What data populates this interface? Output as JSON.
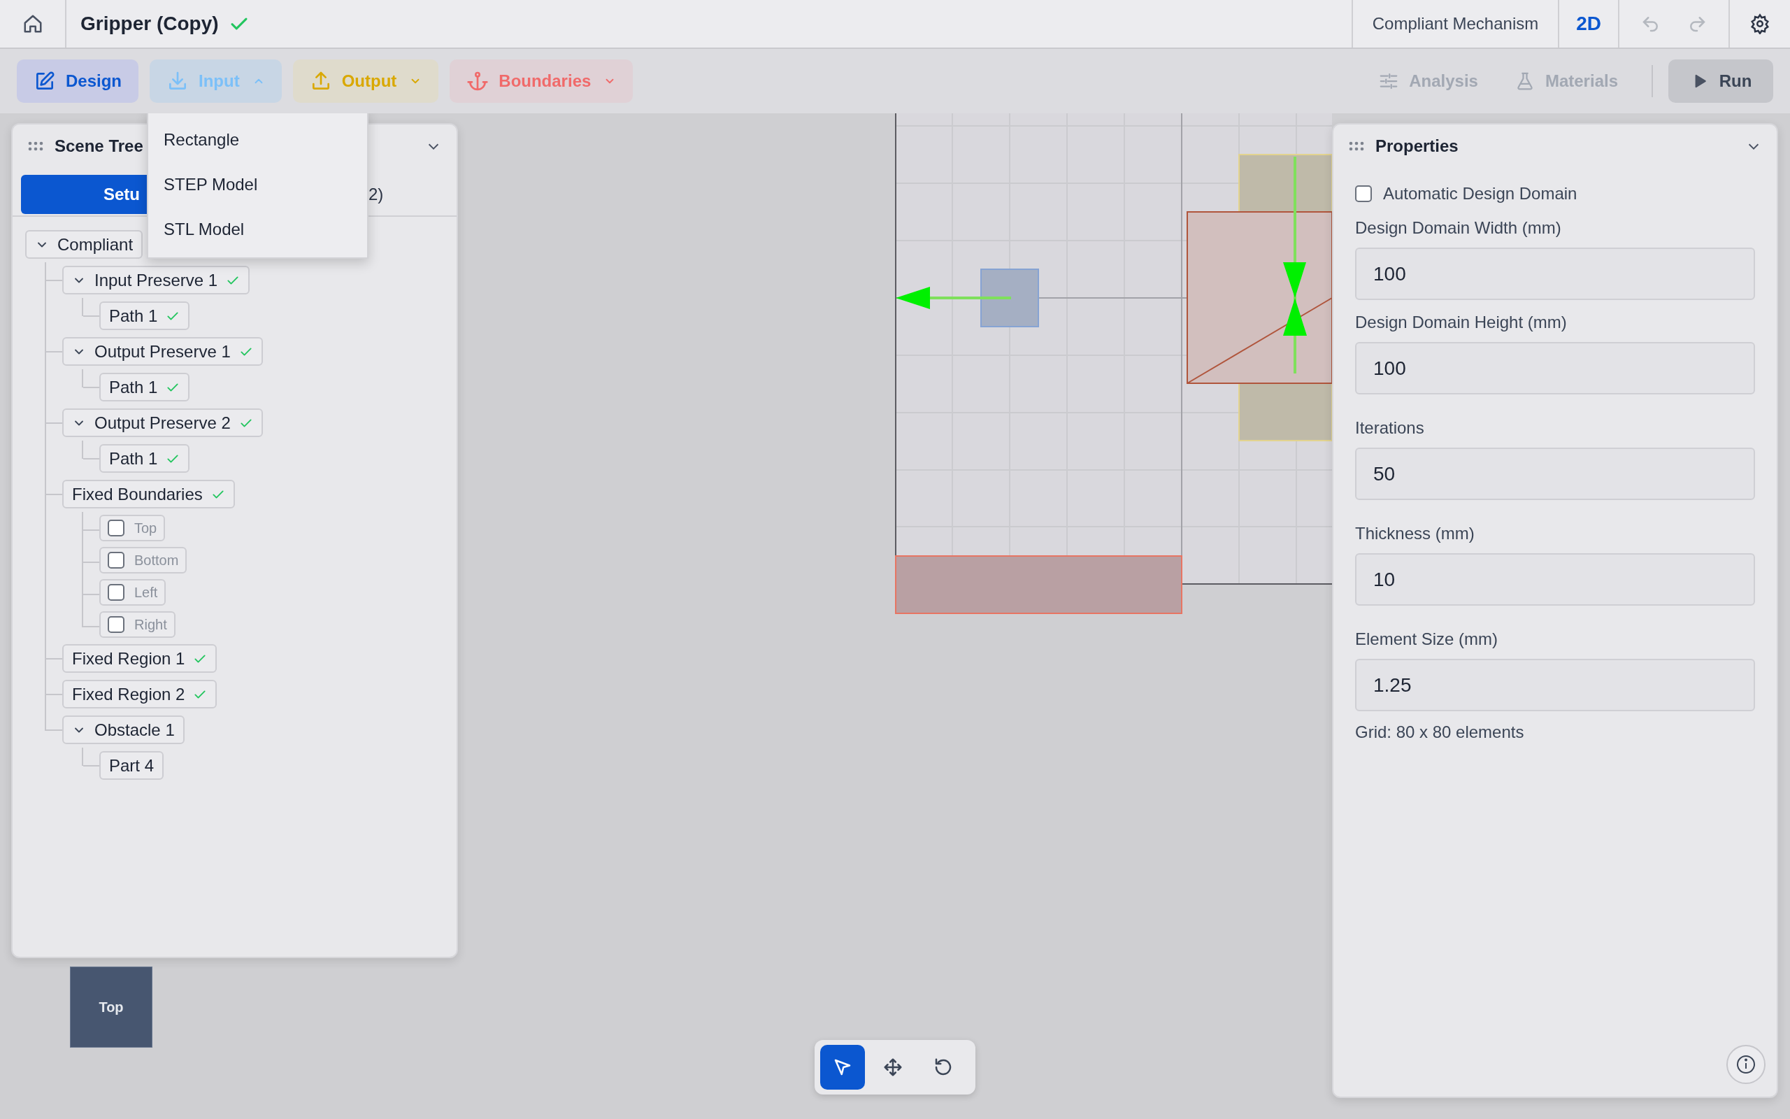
{
  "header": {
    "title": "Gripper (Copy)",
    "saved": true,
    "mode": "Compliant Mechanism",
    "view": "2D"
  },
  "toolbar": {
    "left": [
      {
        "kind": "design",
        "label": "Design",
        "color": "#0b57d0"
      },
      {
        "kind": "input",
        "label": "Input",
        "color": "#7cc0f8",
        "expanded": true
      },
      {
        "kind": "output",
        "label": "Output",
        "color": "#d9a800",
        "expanded": false
      },
      {
        "kind": "boundaries",
        "label": "Boundaries",
        "color": "#f06a6a",
        "expanded": false
      }
    ],
    "right": [
      {
        "kind": "analysis",
        "label": "Analysis",
        "disabled": true
      },
      {
        "kind": "materials",
        "label": "Materials",
        "disabled": true
      }
    ],
    "run": {
      "label": "Run"
    }
  },
  "dropdown": {
    "items": [
      "Rectangle",
      "STEP Model",
      "STL Model"
    ]
  },
  "scene_tree": {
    "title": "Scene Tree",
    "tabs": [
      {
        "label": "Setu",
        "selected": true
      },
      {
        "label": "2)",
        "selected": false
      }
    ],
    "nodes": [
      {
        "label": "Compliant",
        "expanded": true,
        "valid": false,
        "children": [
          {
            "label": "Input Preserve 1",
            "expanded": true,
            "valid": true,
            "children": [
              {
                "label": "Path 1",
                "valid": true
              }
            ]
          },
          {
            "label": "Output Preserve 1",
            "expanded": true,
            "valid": true,
            "children": [
              {
                "label": "Path 1",
                "valid": true
              }
            ]
          },
          {
            "label": "Output Preserve 2",
            "expanded": true,
            "valid": true,
            "children": [
              {
                "label": "Path 1",
                "valid": true
              }
            ]
          },
          {
            "label": "Fixed Boundaries",
            "valid": true,
            "children": [
              {
                "label": "Top",
                "kind": "checkbox",
                "checked": false
              },
              {
                "label": "Bottom",
                "kind": "checkbox",
                "checked": false
              },
              {
                "label": "Left",
                "kind": "checkbox",
                "checked": false
              },
              {
                "label": "Right",
                "kind": "checkbox",
                "checked": false
              }
            ]
          },
          {
            "label": "Fixed Region 1",
            "valid": true
          },
          {
            "label": "Fixed Region 2",
            "valid": true
          },
          {
            "label": "Obstacle 1",
            "expanded": true,
            "valid": false,
            "children": [
              {
                "label": "Part 4",
                "valid": false
              }
            ]
          }
        ]
      }
    ]
  },
  "properties": {
    "title": "Properties",
    "auto_domain": {
      "label": "Automatic Design Domain",
      "checked": false
    },
    "fields": [
      {
        "label": "Design Domain Width (mm)",
        "value": "100"
      },
      {
        "label": "Design Domain Height (mm)",
        "value": "100"
      },
      {
        "label": "Iterations",
        "value": "50"
      },
      {
        "label": "Thickness (mm)",
        "value": "10"
      },
      {
        "label": "Element Size (mm)",
        "value": "1.25"
      }
    ],
    "note": "Grid: 80 x 80 elements"
  },
  "view_cube": {
    "label": "Top"
  },
  "tools": [
    {
      "kind": "select",
      "selected": true
    },
    {
      "kind": "move",
      "selected": false
    },
    {
      "kind": "rotate",
      "selected": false
    }
  ]
}
